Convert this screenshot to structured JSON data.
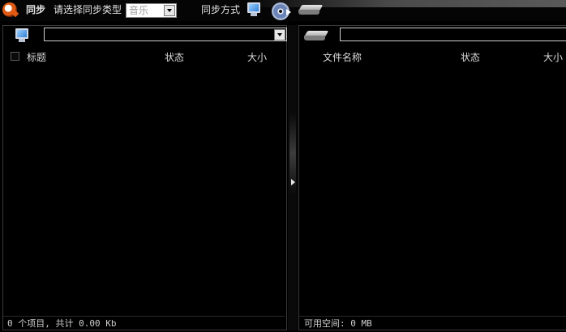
{
  "toolbar": {
    "title": "同步",
    "sync_type_prompt": "请选择同步类型",
    "sync_type_value": "音乐",
    "sync_mode_label": "同步方式",
    "icons": [
      "app-logo-icon",
      "computer-icon",
      "disc-sync-icon",
      "removable-drive-icon"
    ]
  },
  "left_panel": {
    "source_icon": "computer-icon",
    "path_value": "",
    "columns": [
      "标题",
      "状态",
      "大小"
    ],
    "items": [],
    "status": "0 个项目, 共计 0.00 Kb"
  },
  "right_panel": {
    "device_icon": "removable-drive-icon",
    "path_value": "",
    "columns": [
      "文件名称",
      "状态",
      "大小"
    ],
    "items": [],
    "status": "可用空间: 0 MB"
  },
  "colors": {
    "background": "#000000",
    "text": "#d8d8d8",
    "border": "#3a3a3a",
    "accent": "#e05a14"
  }
}
